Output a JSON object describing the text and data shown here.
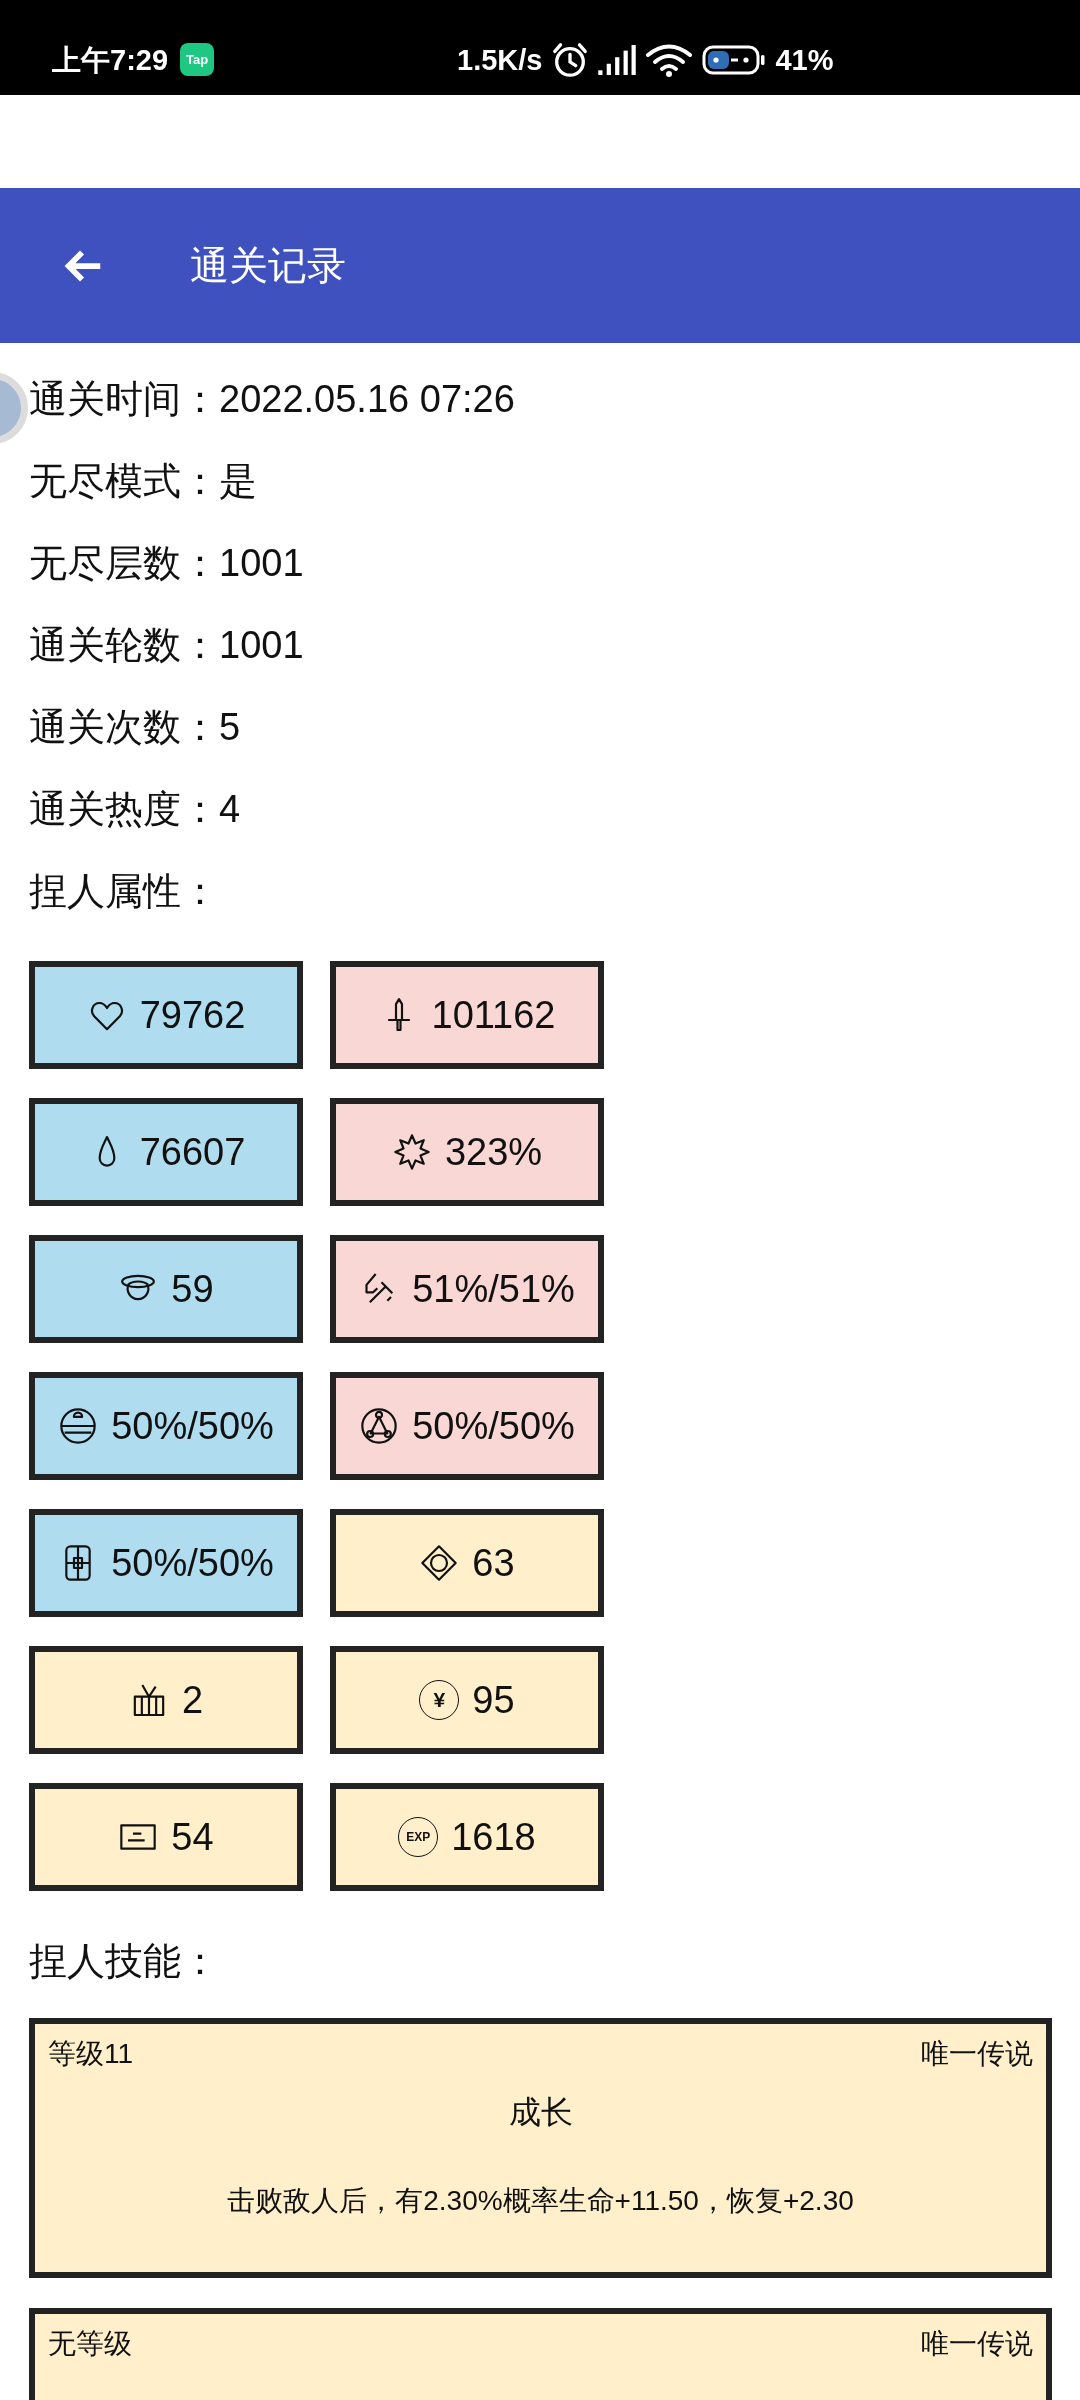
{
  "status_bar": {
    "time": "上午7:29",
    "app_badge": "Tap",
    "net_speed": "1.5K/s",
    "battery_percent": "41%"
  },
  "app_bar": {
    "title": "通关记录"
  },
  "record": [
    {
      "label": "通关时间：",
      "value": "2022.05.16 07:26"
    },
    {
      "label": "无尽模式：",
      "value": "是"
    },
    {
      "label": "无尽层数：",
      "value": "1001"
    },
    {
      "label": "通关轮数：",
      "value": "1001"
    },
    {
      "label": "通关次数：",
      "value": "5"
    },
    {
      "label": "通关热度：",
      "value": "4"
    }
  ],
  "attributes_heading": "捏人属性：",
  "attributes": [
    {
      "kind": "heart",
      "color": "#b0dcef",
      "value": "79762"
    },
    {
      "kind": "sword",
      "color": "#f9d7d4",
      "value": "101162"
    },
    {
      "kind": "drop",
      "color": "#b0dcef",
      "value": "76607"
    },
    {
      "kind": "burst",
      "color": "#f9d7d4",
      "value": "323%"
    },
    {
      "kind": "helmet",
      "color": "#b0dcef",
      "value": "59"
    },
    {
      "kind": "tool",
      "color": "#f9d7d4",
      "value": "51%/51%"
    },
    {
      "kind": "orb",
      "color": "#b0dcef",
      "value": "50%/50%"
    },
    {
      "kind": "triangle_orb",
      "color": "#f9d7d4",
      "value": "50%/50%"
    },
    {
      "kind": "panel",
      "color": "#b0dcef",
      "value": "50%/50%"
    },
    {
      "kind": "diamond",
      "color": "#fff0cb",
      "value": "63"
    },
    {
      "kind": "basket",
      "color": "#fff0cb",
      "value": "2"
    },
    {
      "kind": "coin",
      "color": "#fff0cb",
      "icon_text": "¥",
      "value": "95"
    },
    {
      "kind": "card",
      "color": "#fff0cb",
      "value": "54"
    },
    {
      "kind": "exp",
      "color": "#fff0cb",
      "icon_text": "EXP",
      "value": "1618"
    }
  ],
  "skills_heading": "捏人技能：",
  "skills": [
    {
      "level": "等级11",
      "rarity": "唯一传说",
      "name": "成长",
      "description": "击败敌人后，有2.30%概率生命+11.50，恢复+2.30"
    },
    {
      "level": "无等级",
      "rarity": "唯一传说"
    }
  ]
}
